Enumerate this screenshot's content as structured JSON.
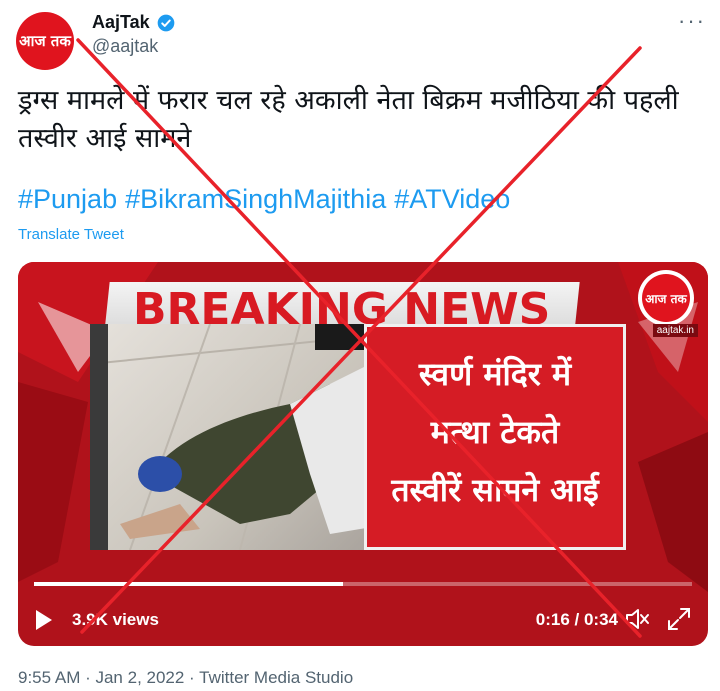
{
  "account": {
    "name": "AajTak",
    "handle": "@aajtak",
    "avatar_text": "आज तक",
    "more_label": "···"
  },
  "tweet": {
    "text": "ड्रग्स मामले में फरार चल रहे अकाली नेता बिक्रम मजीठिया की पहली तस्वीर आई सामने",
    "hashtags": [
      "#Punjab",
      "#BikramSinghMajithia",
      "#ATVideo"
    ],
    "translate_label": "Translate Tweet",
    "meta": "9:55 AM · Jan 2, 2022 · Twitter Media Studio"
  },
  "video": {
    "headline": "BREAKING NEWS",
    "channel_logo_text": "आज तक",
    "channel_url": "aajtak.in",
    "panel_lines": [
      "स्वर्ण मंदिर में",
      "मत्था टेकते",
      "तस्वीरें सामने आई"
    ],
    "views": "3.9K views",
    "time": "0:16 / 0:34",
    "progress": 0.47
  },
  "colors": {
    "brand_red": "#e0141e",
    "link_blue": "#1d9bf0",
    "cross_red": "#e8222a",
    "muted": "#536471"
  }
}
